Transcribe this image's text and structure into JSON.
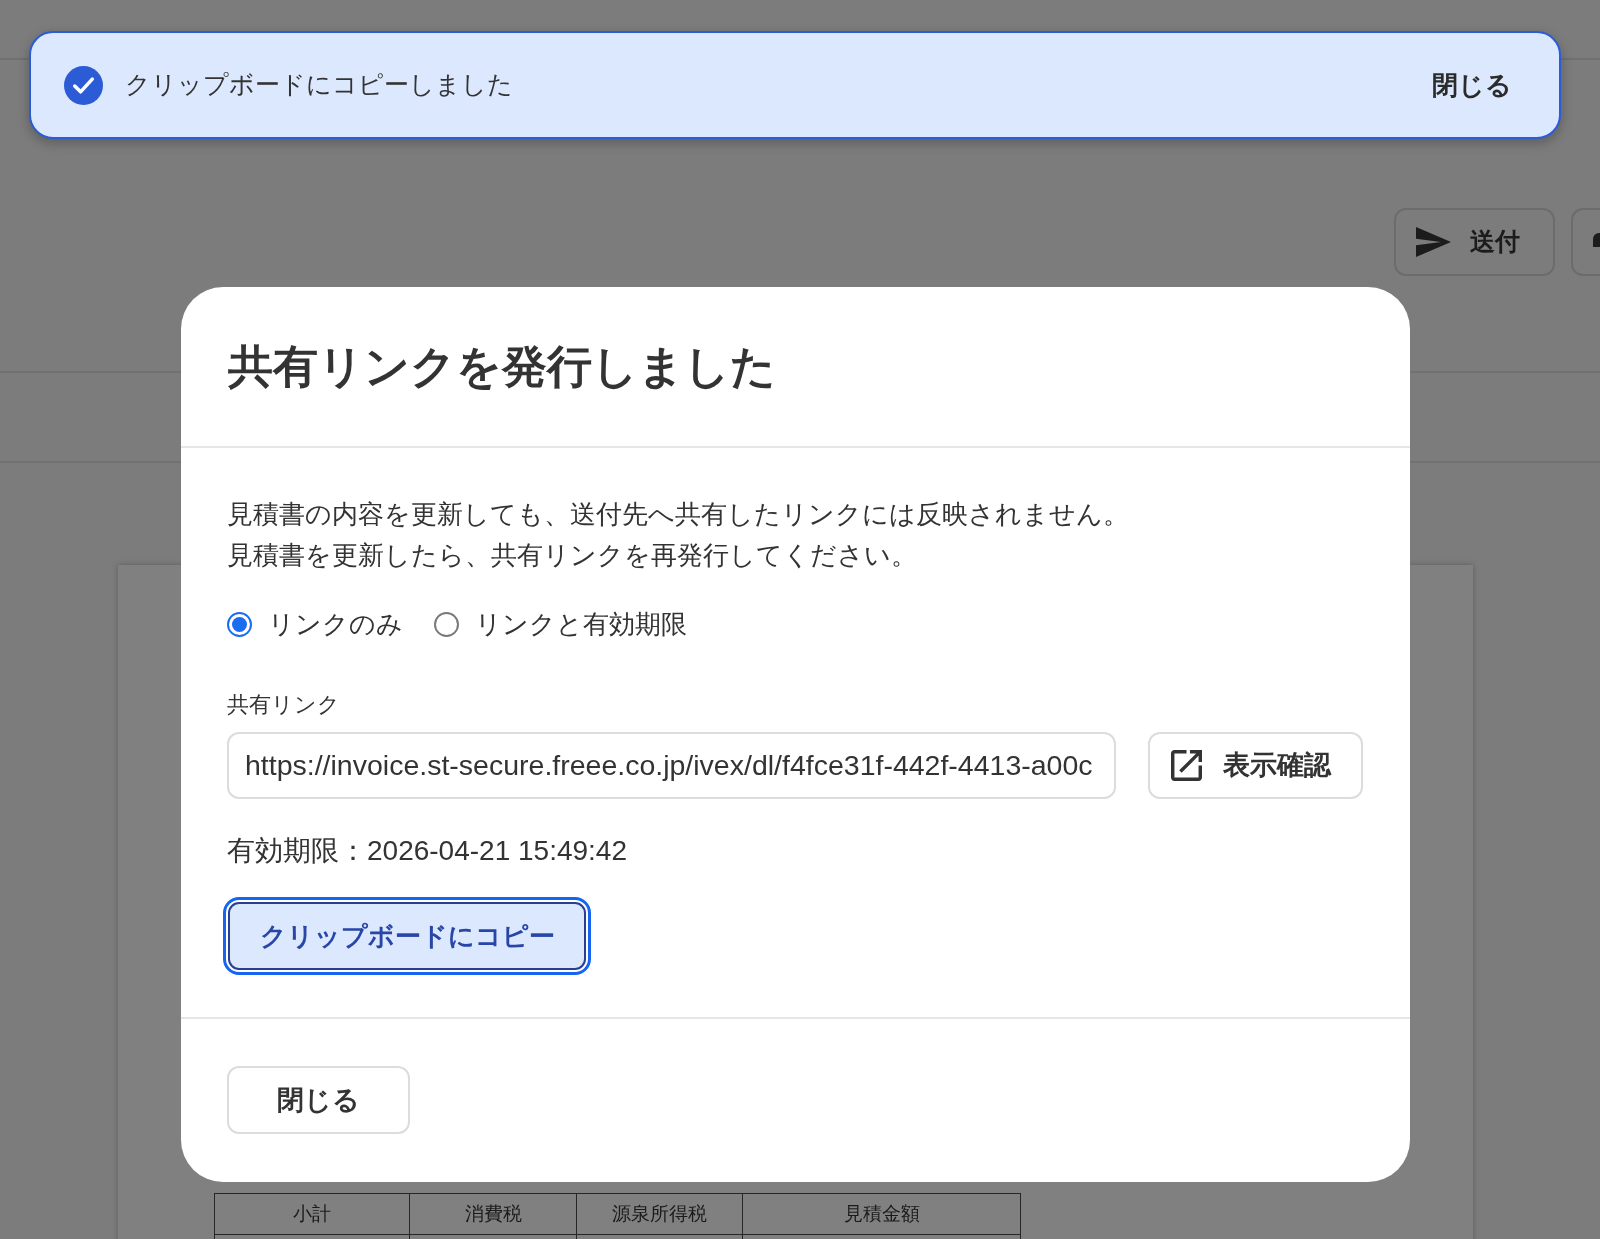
{
  "toast": {
    "message": "クリップボードにコピーしました",
    "close_label": "閉じる"
  },
  "toolbar": {
    "buttons": [
      {
        "kind": "send",
        "label": "送付"
      },
      {
        "kind": "cropped"
      }
    ]
  },
  "dialog": {
    "title": "共有リンクを発行しました",
    "description_lines": [
      "見積書の内容を更新しても、送付先へ共有したリンクには反映されません。",
      "見積書を更新したら、共有リンクを再発行してください。"
    ],
    "link_options": [
      {
        "label": "リンクのみ",
        "selected": true
      },
      {
        "label": "リンクと有効期限",
        "selected": false
      }
    ],
    "link_field": {
      "label": "共有リンク",
      "value": "https://invoice.st-secure.freee.co.jp/ivex/dl/f4fce31f-442f-4413-a00c"
    },
    "preview_button": {
      "label": "表示確認"
    },
    "expiry": "有効期限：2026-04-21 15:49:42",
    "copy_button": {
      "label": "クリップボードにコピー",
      "focused": true
    },
    "close_button": {
      "label": "閉じる"
    }
  },
  "document": {
    "table_columns": [
      "小計",
      "消費税",
      "源泉所得税",
      "見積金額"
    ]
  }
}
